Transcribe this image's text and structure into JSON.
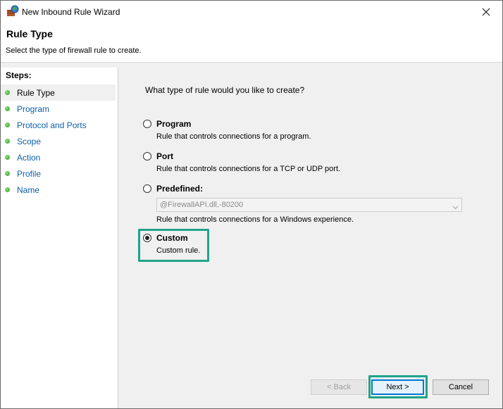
{
  "window": {
    "title": "New Inbound Rule Wizard"
  },
  "header": {
    "title": "Rule Type",
    "description": "Select the type of firewall rule to create."
  },
  "steps": {
    "label": "Steps:",
    "items": [
      {
        "label": "Rule Type",
        "active": true
      },
      {
        "label": "Program",
        "active": false
      },
      {
        "label": "Protocol and Ports",
        "active": false
      },
      {
        "label": "Scope",
        "active": false
      },
      {
        "label": "Action",
        "active": false
      },
      {
        "label": "Profile",
        "active": false
      },
      {
        "label": "Name",
        "active": false
      }
    ]
  },
  "main": {
    "question": "What type of rule would you like to create?",
    "options": {
      "program": {
        "label": "Program",
        "description": "Rule that controls connections for a program.",
        "selected": false
      },
      "port": {
        "label": "Port",
        "description": "Rule that controls connections for a TCP or UDP port.",
        "selected": false
      },
      "predefined": {
        "label": "Predefined:",
        "select_value": "@FirewallAPI.dll,-80200",
        "description": "Rule that controls connections for a Windows experience.",
        "selected": false
      },
      "custom": {
        "label": "Custom",
        "description": "Custom rule.",
        "selected": true
      }
    }
  },
  "buttons": {
    "back": "< Back",
    "next": "Next >",
    "cancel": "Cancel"
  },
  "colors": {
    "highlight": "#21a38a",
    "link": "#0b5fa8",
    "default_button": "#0078d7"
  },
  "icons": {
    "app": "firewall-wizard-icon",
    "close": "close-icon",
    "step": "green-dot-icon",
    "dropdown": "chevron-down-icon"
  }
}
